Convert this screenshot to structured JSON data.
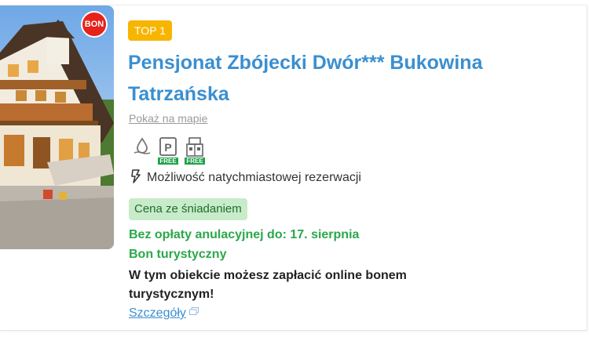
{
  "hotel": {
    "bon_badge": "BON",
    "rank_badge": "TOP 1",
    "name": "Pensjonat Zbójecki Dwór*** Bukowina Tatrzańska",
    "map_link": "Pokaż na mapie",
    "amenities": [
      {
        "icon": "water-drop-icon"
      },
      {
        "icon": "parking-icon",
        "tag": "FREE"
      },
      {
        "icon": "garage-icon",
        "tag": "FREE"
      }
    ],
    "instant_booking": "Możliwość natychmiastowej rezerwacji",
    "instant_icon": "lightning-icon",
    "breakfast_badge": "Cena ze śniadaniem",
    "free_cancel": "Bez opłaty anulacyjnej do: 17. sierpnia",
    "voucher_title": "Bon turystyczny",
    "voucher_desc": "W tym obiekcie możesz zapłacić online bonem turystycznym!",
    "details_link": "Szczegóły",
    "details_icon": "external-window-icon"
  },
  "colors": {
    "title": "#3a8fd0",
    "rank_badge": "#f7b500",
    "bon_badge": "#e5231b",
    "green_text": "#2aa84a",
    "breakfast_bg": "#c8ebc9",
    "free_tag": "#1ea14a"
  }
}
